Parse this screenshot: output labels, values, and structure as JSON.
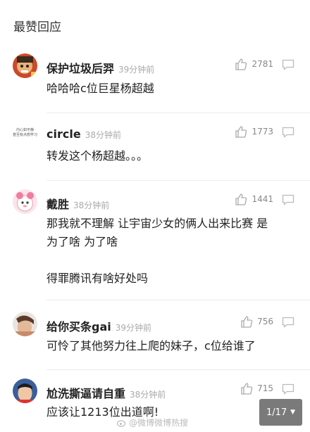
{
  "section_title": "最赞回应",
  "comments": [
    {
      "name": "保护垃圾后羿",
      "time": "39分钟前",
      "likes": "2781",
      "text": "哈哈哈c位巨星杨超越"
    },
    {
      "name": "circle",
      "time": "38分钟前",
      "likes": "1773",
      "text": "转发这个杨超越。。。",
      "avatar_text": "内心如平静\n甚至有点想学习"
    },
    {
      "name": "戴胜",
      "time": "38分钟前",
      "likes": "1441",
      "text": "那我就不理解 让宇宙少女的俩人出来比赛 是\n为了啥 为了啥\n\n得罪腾讯有啥好处吗"
    },
    {
      "name": "给你买条gai",
      "time": "39分钟前",
      "likes": "756",
      "text": "可怜了其他努力往上爬的妹子，c位给谁了"
    },
    {
      "name": "尬洗撕逼请自重",
      "time": "38分钟前",
      "likes": "715",
      "text": "应该让1213位出道啊!"
    }
  ],
  "pager": {
    "label": "1/17"
  },
  "watermark": "@微博微博热搜"
}
